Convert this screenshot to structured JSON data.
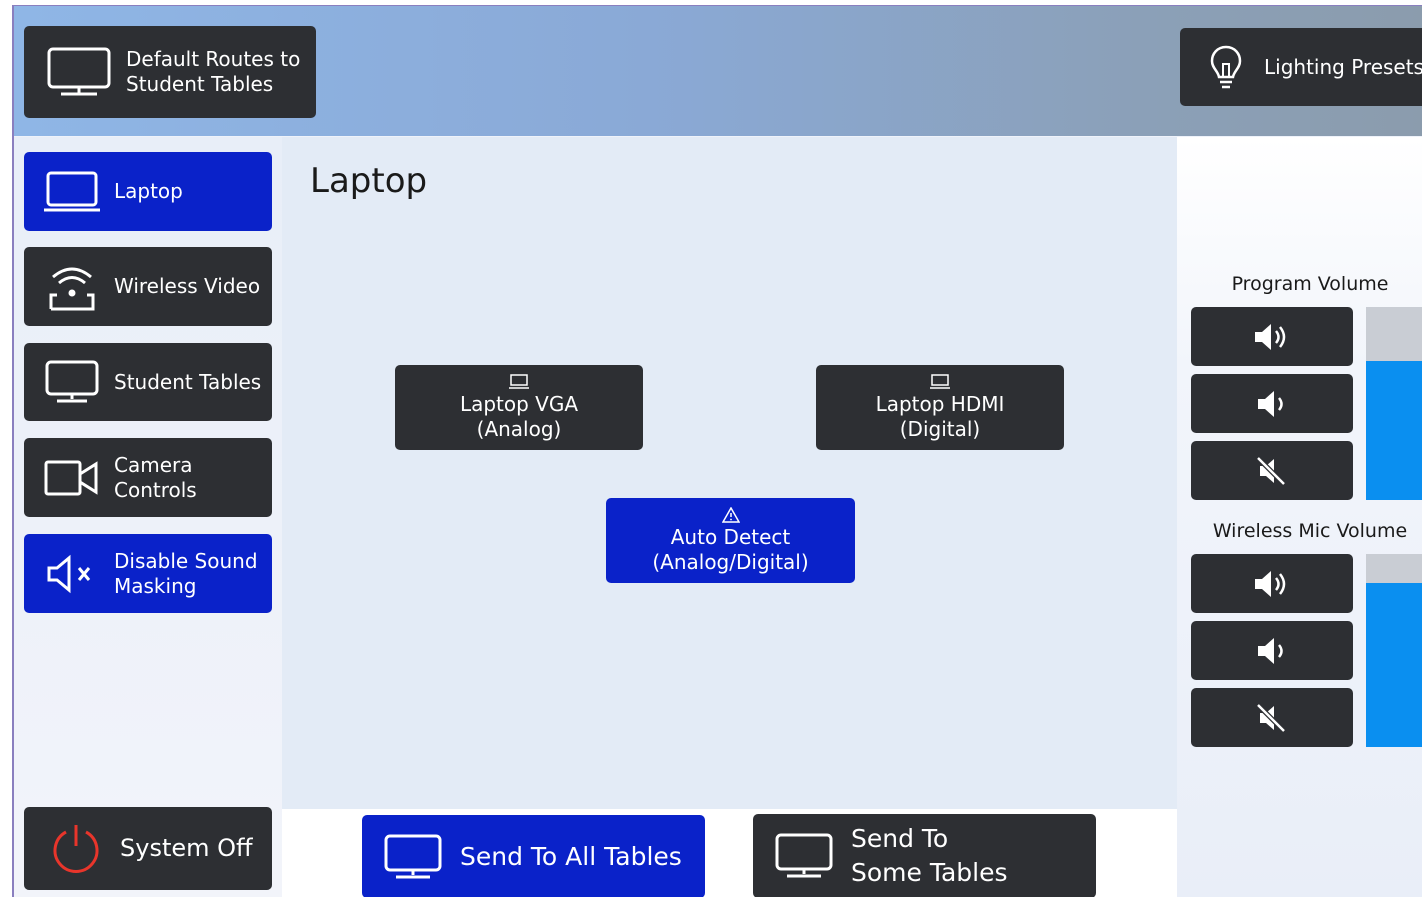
{
  "header": {
    "default_routes_label": "Default Routes to\nStudent Tables",
    "lighting_label": "Lighting Presets"
  },
  "sidebar": {
    "items": [
      {
        "label": "Laptop",
        "icon": "laptop-icon",
        "active": true
      },
      {
        "label": "Wireless Video",
        "icon": "wireless-video-icon",
        "active": false
      },
      {
        "label": "Student Tables",
        "icon": "monitor-icon",
        "active": false
      },
      {
        "label": "Camera\nControls",
        "icon": "camera-icon",
        "active": false
      },
      {
        "label": "Disable Sound\nMasking",
        "icon": "speaker-mute-icon",
        "active": true
      }
    ],
    "system_off_label": "System Off"
  },
  "main": {
    "title": "Laptop",
    "sources": [
      {
        "label": "Laptop VGA\n(Analog)",
        "icon": "laptop-icon",
        "selected": false
      },
      {
        "label": "Laptop HDMI\n(Digital)",
        "icon": "laptop-icon",
        "selected": false
      },
      {
        "label": "Auto Detect\n(Analog/Digital)",
        "icon": "warning-icon",
        "selected": true
      }
    ]
  },
  "bottom": {
    "send_all_label": "Send To All Tables",
    "send_some_label": "Send To\nSome Tables"
  },
  "volume": {
    "program_title": "Program Volume",
    "program_level": 0.72,
    "mic_title": "Wireless Mic Volume",
    "mic_level": 0.85
  },
  "colors": {
    "accent": "#0a22c9",
    "dark_button": "#2d2f33",
    "meter_fill": "#0a8ff0",
    "power": "#e8352b"
  }
}
